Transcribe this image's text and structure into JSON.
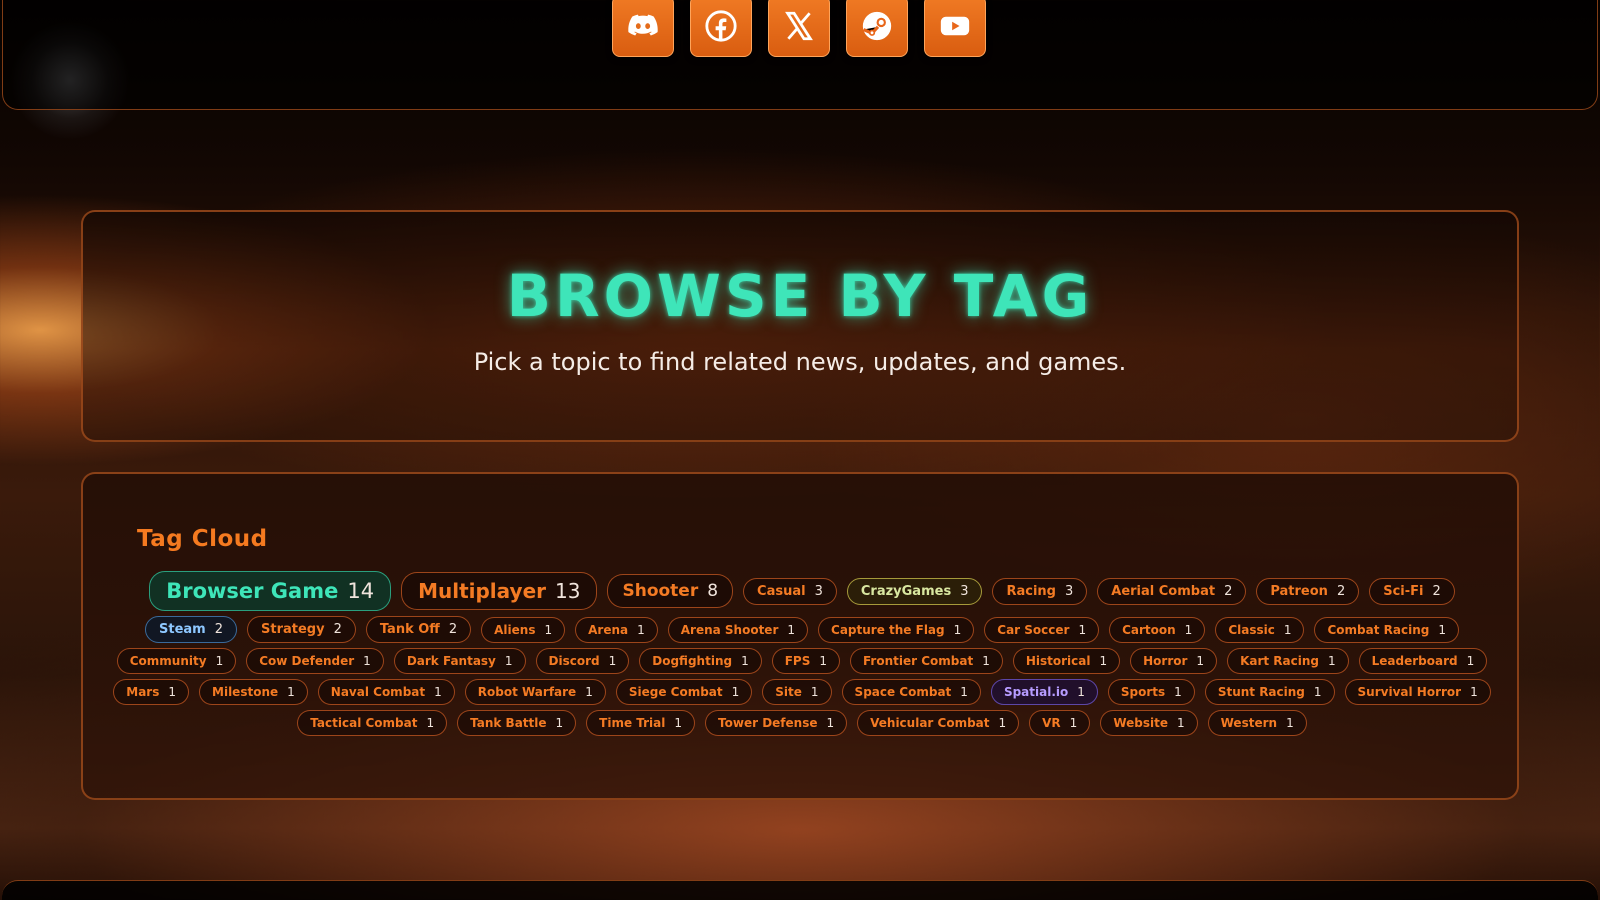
{
  "social": [
    {
      "name": "discord-icon"
    },
    {
      "name": "facebook-icon"
    },
    {
      "name": "x-icon"
    },
    {
      "name": "steam-icon"
    },
    {
      "name": "youtube-icon"
    }
  ],
  "hero": {
    "title": "BROWSE BY TAG",
    "subtitle": "Pick a topic to find related news, updates, and games."
  },
  "cloud": {
    "title": "Tag Cloud",
    "rows": [
      [
        {
          "label": "Browser Game",
          "count": "14",
          "size": "xl",
          "variant": "green"
        },
        {
          "label": "Multiplayer",
          "count": "13",
          "size": "l"
        },
        {
          "label": "Shooter",
          "count": "8",
          "size": "m"
        },
        {
          "label": "Casual",
          "count": "3",
          "size": "s"
        },
        {
          "label": "CrazyGames",
          "count": "3",
          "size": "s",
          "variant": "lime"
        },
        {
          "label": "Racing",
          "count": "3",
          "size": "s"
        },
        {
          "label": "Aerial Combat",
          "count": "2",
          "size": "s"
        },
        {
          "label": "Patreon",
          "count": "2",
          "size": "s"
        },
        {
          "label": "Sci-Fi",
          "count": "2",
          "size": "s"
        }
      ],
      [
        {
          "label": "Steam",
          "count": "2",
          "size": "s",
          "variant": "blue"
        },
        {
          "label": "Strategy",
          "count": "2",
          "size": "s"
        },
        {
          "label": "Tank Off",
          "count": "2",
          "size": "s"
        },
        {
          "label": "Aliens",
          "count": "1",
          "size": "xs"
        },
        {
          "label": "Arena",
          "count": "1",
          "size": "xs"
        },
        {
          "label": "Arena Shooter",
          "count": "1",
          "size": "xs"
        },
        {
          "label": "Capture the Flag",
          "count": "1",
          "size": "xs"
        },
        {
          "label": "Car Soccer",
          "count": "1",
          "size": "xs"
        },
        {
          "label": "Cartoon",
          "count": "1",
          "size": "xs"
        },
        {
          "label": "Classic",
          "count": "1",
          "size": "xs"
        },
        {
          "label": "Combat Racing",
          "count": "1",
          "size": "xs"
        }
      ],
      [
        {
          "label": "Community",
          "count": "1",
          "size": "xs"
        },
        {
          "label": "Cow Defender",
          "count": "1",
          "size": "xs"
        },
        {
          "label": "Dark Fantasy",
          "count": "1",
          "size": "xs"
        },
        {
          "label": "Discord",
          "count": "1",
          "size": "xs"
        },
        {
          "label": "Dogfighting",
          "count": "1",
          "size": "xs"
        },
        {
          "label": "FPS",
          "count": "1",
          "size": "xs"
        },
        {
          "label": "Frontier Combat",
          "count": "1",
          "size": "xs"
        },
        {
          "label": "Historical",
          "count": "1",
          "size": "xs"
        },
        {
          "label": "Horror",
          "count": "1",
          "size": "xs"
        },
        {
          "label": "Kart Racing",
          "count": "1",
          "size": "xs"
        },
        {
          "label": "Leaderboard",
          "count": "1",
          "size": "xs"
        }
      ],
      [
        {
          "label": "Mars",
          "count": "1",
          "size": "xs"
        },
        {
          "label": "Milestone",
          "count": "1",
          "size": "xs"
        },
        {
          "label": "Naval Combat",
          "count": "1",
          "size": "xs"
        },
        {
          "label": "Robot Warfare",
          "count": "1",
          "size": "xs"
        },
        {
          "label": "Siege Combat",
          "count": "1",
          "size": "xs"
        },
        {
          "label": "Site",
          "count": "1",
          "size": "xs"
        },
        {
          "label": "Space Combat",
          "count": "1",
          "size": "xs"
        },
        {
          "label": "Spatial.io",
          "count": "1",
          "size": "xs",
          "variant": "purple"
        },
        {
          "label": "Sports",
          "count": "1",
          "size": "xs"
        },
        {
          "label": "Stunt Racing",
          "count": "1",
          "size": "xs"
        },
        {
          "label": "Survival Horror",
          "count": "1",
          "size": "xs"
        }
      ],
      [
        {
          "label": "Tactical Combat",
          "count": "1",
          "size": "xs"
        },
        {
          "label": "Tank Battle",
          "count": "1",
          "size": "xs"
        },
        {
          "label": "Time Trial",
          "count": "1",
          "size": "xs"
        },
        {
          "label": "Tower Defense",
          "count": "1",
          "size": "xs"
        },
        {
          "label": "Vehicular Combat",
          "count": "1",
          "size": "xs"
        },
        {
          "label": "VR",
          "count": "1",
          "size": "xs"
        },
        {
          "label": "Website",
          "count": "1",
          "size": "xs"
        },
        {
          "label": "Western",
          "count": "1",
          "size": "xs"
        }
      ]
    ]
  },
  "colors": {
    "accent": "#f47b24",
    "title_glow": "#3ee5b9",
    "button": "#e8661a"
  }
}
